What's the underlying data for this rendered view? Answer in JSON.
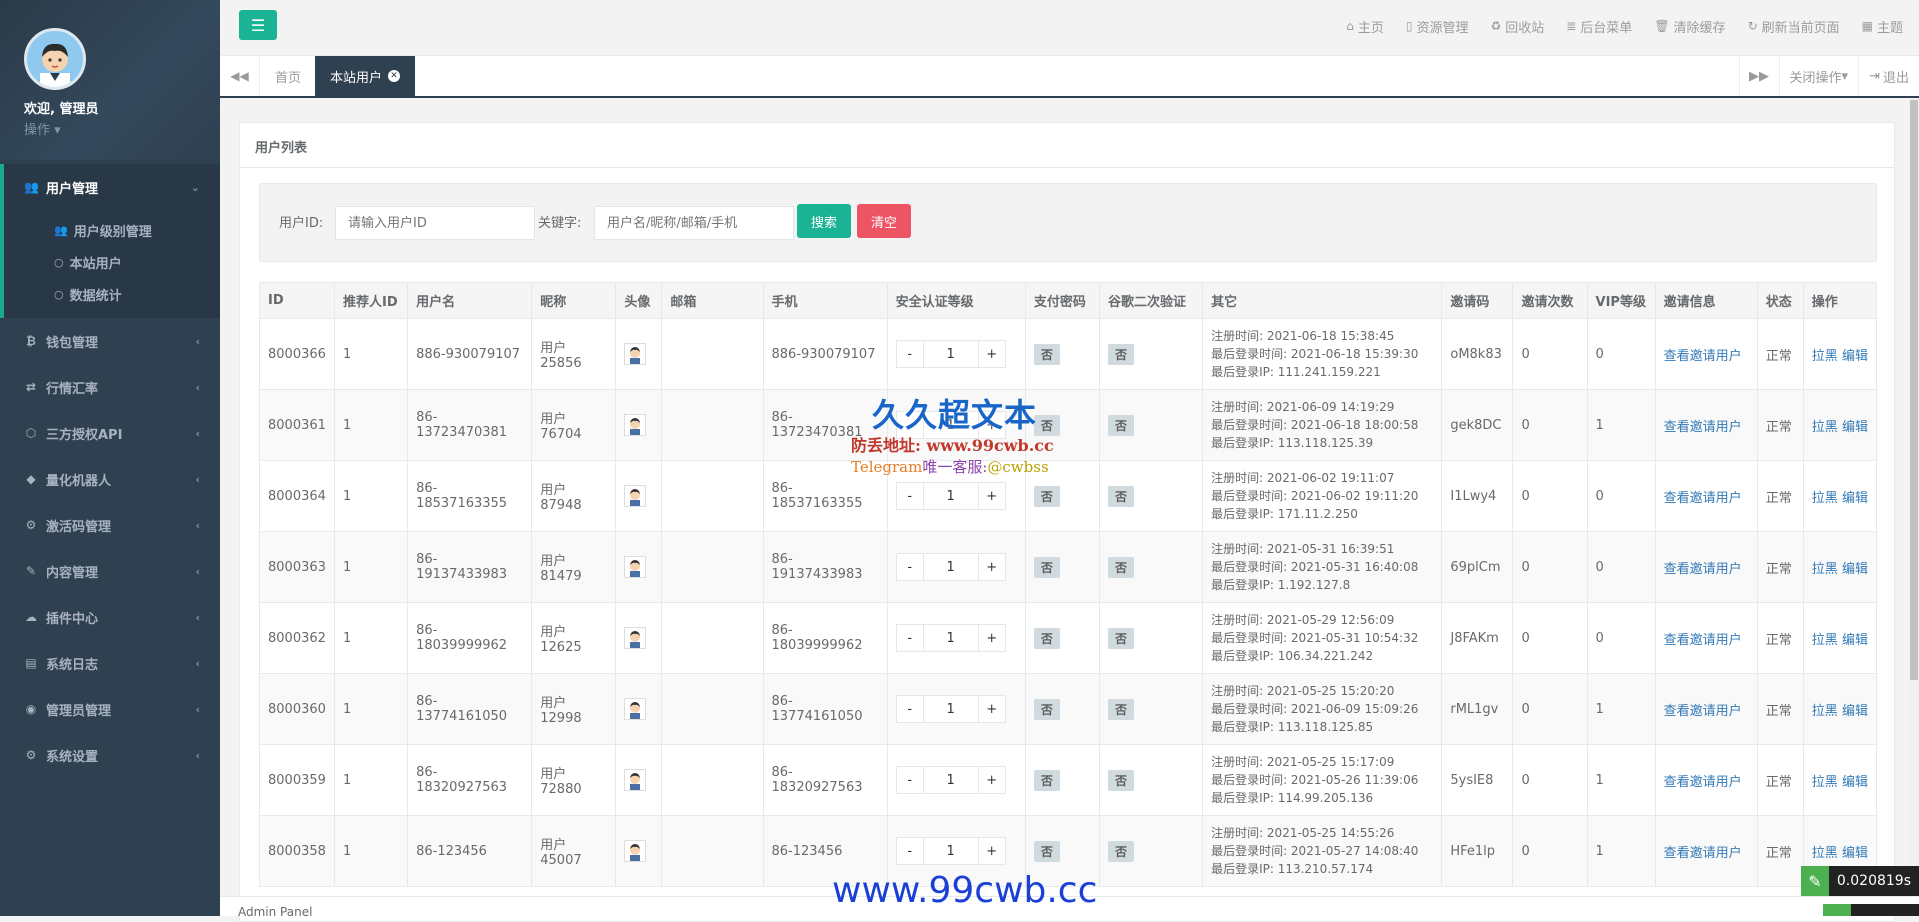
{
  "sidebar": {
    "welcome": "欢迎, 管理员",
    "operations": "操作",
    "menu": [
      {
        "label": "用户管理",
        "icon": "users-icon",
        "expanded": true,
        "children": [
          {
            "label": "用户级别管理",
            "icon": "users-icon"
          },
          {
            "label": "本站用户",
            "icon": "circle-icon"
          },
          {
            "label": "数据统计",
            "icon": "circle-icon"
          }
        ]
      },
      {
        "label": "钱包管理",
        "icon": "bitcoin-icon"
      },
      {
        "label": "行情汇率",
        "icon": "exchange-icon"
      },
      {
        "label": "三方授权API",
        "icon": "cube-icon"
      },
      {
        "label": "量化机器人",
        "icon": "robot-icon"
      },
      {
        "label": "激活码管理",
        "icon": "gear-icon"
      },
      {
        "label": "内容管理",
        "icon": "edit-icon"
      },
      {
        "label": "插件中心",
        "icon": "cloud-icon"
      },
      {
        "label": "系统日志",
        "icon": "database-icon"
      },
      {
        "label": "管理员管理",
        "icon": "user-circle-icon"
      },
      {
        "label": "系统设置",
        "icon": "gears-icon"
      }
    ]
  },
  "topbar": {
    "links": [
      {
        "label": "主页",
        "icon": "home-icon"
      },
      {
        "label": "资源管理",
        "icon": "file-icon"
      },
      {
        "label": "回收站",
        "icon": "recycle-icon"
      },
      {
        "label": "后台菜单",
        "icon": "list-icon"
      },
      {
        "label": "清除缓存",
        "icon": "trash-icon"
      },
      {
        "label": "刷新当前页面",
        "icon": "refresh-icon"
      },
      {
        "label": "主题",
        "icon": "theme-icon"
      }
    ]
  },
  "tabs": {
    "home": "首页",
    "current": "本站用户",
    "close_ops": "关闭操作",
    "logout": "退出"
  },
  "panel": {
    "title": "用户列表",
    "search": {
      "id_label": "用户ID:",
      "id_placeholder": "请输入用户ID",
      "keyword_label": "关键字:",
      "keyword_placeholder": "用户名/昵称/邮箱/手机",
      "search_btn": "搜索",
      "clear_btn": "清空"
    },
    "columns": [
      "ID",
      "推荐人ID",
      "用户名",
      "昵称",
      "头像",
      "邮箱",
      "手机",
      "安全认证等级",
      "支付密码",
      "谷歌二次验证",
      "其它",
      "邀请码",
      "邀请次数",
      "VIP等级",
      "邀请信息",
      "状态",
      "操作"
    ],
    "rows": [
      {
        "id": "8000366",
        "ref": "1",
        "username": "886-930079107",
        "nick": "用户25856",
        "email": "",
        "phone": "886-930079107",
        "level": "1",
        "paypwd": "否",
        "google": "否",
        "reg": "注册时间: 2021-06-18 15:38:45",
        "last": "最后登录时间: 2021-06-18 15:39:30",
        "ip": "最后登录IP: 111.241.159.221",
        "code": "oM8k83",
        "invites": "0",
        "vip": "0",
        "invite_link": "查看邀请用户",
        "status": "正常",
        "act1": "拉黑",
        "act2": "编辑"
      },
      {
        "id": "8000361",
        "ref": "1",
        "username": "86-13723470381",
        "nick": "用户76704",
        "email": "",
        "phone": "86-13723470381",
        "level": "1",
        "paypwd": "否",
        "google": "否",
        "reg": "注册时间: 2021-06-09 14:19:29",
        "last": "最后登录时间: 2021-06-18 18:00:58",
        "ip": "最后登录IP: 113.118.125.39",
        "code": "gek8DC",
        "invites": "0",
        "vip": "1",
        "invite_link": "查看邀请用户",
        "status": "正常",
        "act1": "拉黑",
        "act2": "编辑"
      },
      {
        "id": "8000364",
        "ref": "1",
        "username": "86-18537163355",
        "nick": "用户87948",
        "email": "",
        "phone": "86-18537163355",
        "level": "1",
        "paypwd": "否",
        "google": "否",
        "reg": "注册时间: 2021-06-02 19:11:07",
        "last": "最后登录时间: 2021-06-02 19:11:20",
        "ip": "最后登录IP: 171.11.2.250",
        "code": "I1Lwy4",
        "invites": "0",
        "vip": "0",
        "invite_link": "查看邀请用户",
        "status": "正常",
        "act1": "拉黑",
        "act2": "编辑"
      },
      {
        "id": "8000363",
        "ref": "1",
        "username": "86-19137433983",
        "nick": "用户81479",
        "email": "",
        "phone": "86-19137433983",
        "level": "1",
        "paypwd": "否",
        "google": "否",
        "reg": "注册时间: 2021-05-31 16:39:51",
        "last": "最后登录时间: 2021-05-31 16:40:08",
        "ip": "最后登录IP: 1.192.127.8",
        "code": "69plCm",
        "invites": "0",
        "vip": "0",
        "invite_link": "查看邀请用户",
        "status": "正常",
        "act1": "拉黑",
        "act2": "编辑"
      },
      {
        "id": "8000362",
        "ref": "1",
        "username": "86-18039999962",
        "nick": "用户12625",
        "email": "",
        "phone": "86-18039999962",
        "level": "1",
        "paypwd": "否",
        "google": "否",
        "reg": "注册时间: 2021-05-29 12:56:09",
        "last": "最后登录时间: 2021-05-31 10:54:32",
        "ip": "最后登录IP: 106.34.221.242",
        "code": "J8FAKm",
        "invites": "0",
        "vip": "0",
        "invite_link": "查看邀请用户",
        "status": "正常",
        "act1": "拉黑",
        "act2": "编辑"
      },
      {
        "id": "8000360",
        "ref": "1",
        "username": "86-13774161050",
        "nick": "用户12998",
        "email": "",
        "phone": "86-13774161050",
        "level": "1",
        "paypwd": "否",
        "google": "否",
        "reg": "注册时间: 2021-05-25 15:20:20",
        "last": "最后登录时间: 2021-06-09 15:09:26",
        "ip": "最后登录IP: 113.118.125.85",
        "code": "rML1gv",
        "invites": "0",
        "vip": "1",
        "invite_link": "查看邀请用户",
        "status": "正常",
        "act1": "拉黑",
        "act2": "编辑"
      },
      {
        "id": "8000359",
        "ref": "1",
        "username": "86-18320927563",
        "nick": "用户72880",
        "email": "",
        "phone": "86-18320927563",
        "level": "1",
        "paypwd": "否",
        "google": "否",
        "reg": "注册时间: 2021-05-25 15:17:09",
        "last": "最后登录时间: 2021-05-26 11:39:06",
        "ip": "最后登录IP: 114.99.205.136",
        "code": "5ysIE8",
        "invites": "0",
        "vip": "1",
        "invite_link": "查看邀请用户",
        "status": "正常",
        "act1": "拉黑",
        "act2": "编辑"
      },
      {
        "id": "8000358",
        "ref": "1",
        "username": "86-123456",
        "nick": "用户45007",
        "email": "",
        "phone": "86-123456",
        "level": "1",
        "paypwd": "否",
        "google": "否",
        "reg": "注册时间: 2021-05-25 14:55:26",
        "last": "最后登录时间: 2021-05-27 14:08:40",
        "ip": "最后登录IP: 113.210.57.174",
        "code": "HFe1lp",
        "invites": "0",
        "vip": "1",
        "invite_link": "查看邀请用户",
        "status": "正常",
        "act1": "拉黑",
        "act2": "编辑"
      }
    ]
  },
  "footer": {
    "text": "Admin Panel"
  },
  "watermark": {
    "title": "久久超文本",
    "addr": "防丢地址: www.99cwb.cc",
    "tg_a": "Telegram",
    "tg_b": "唯一客服:",
    "tg_c": "@cwbss",
    "url": "www.99cwb.cc"
  },
  "timer": {
    "value": "0.020819s"
  },
  "colors": {
    "sidebar": "#2f4050",
    "accent": "#1ab394",
    "danger": "#ed5565",
    "link": "#337ab7"
  }
}
